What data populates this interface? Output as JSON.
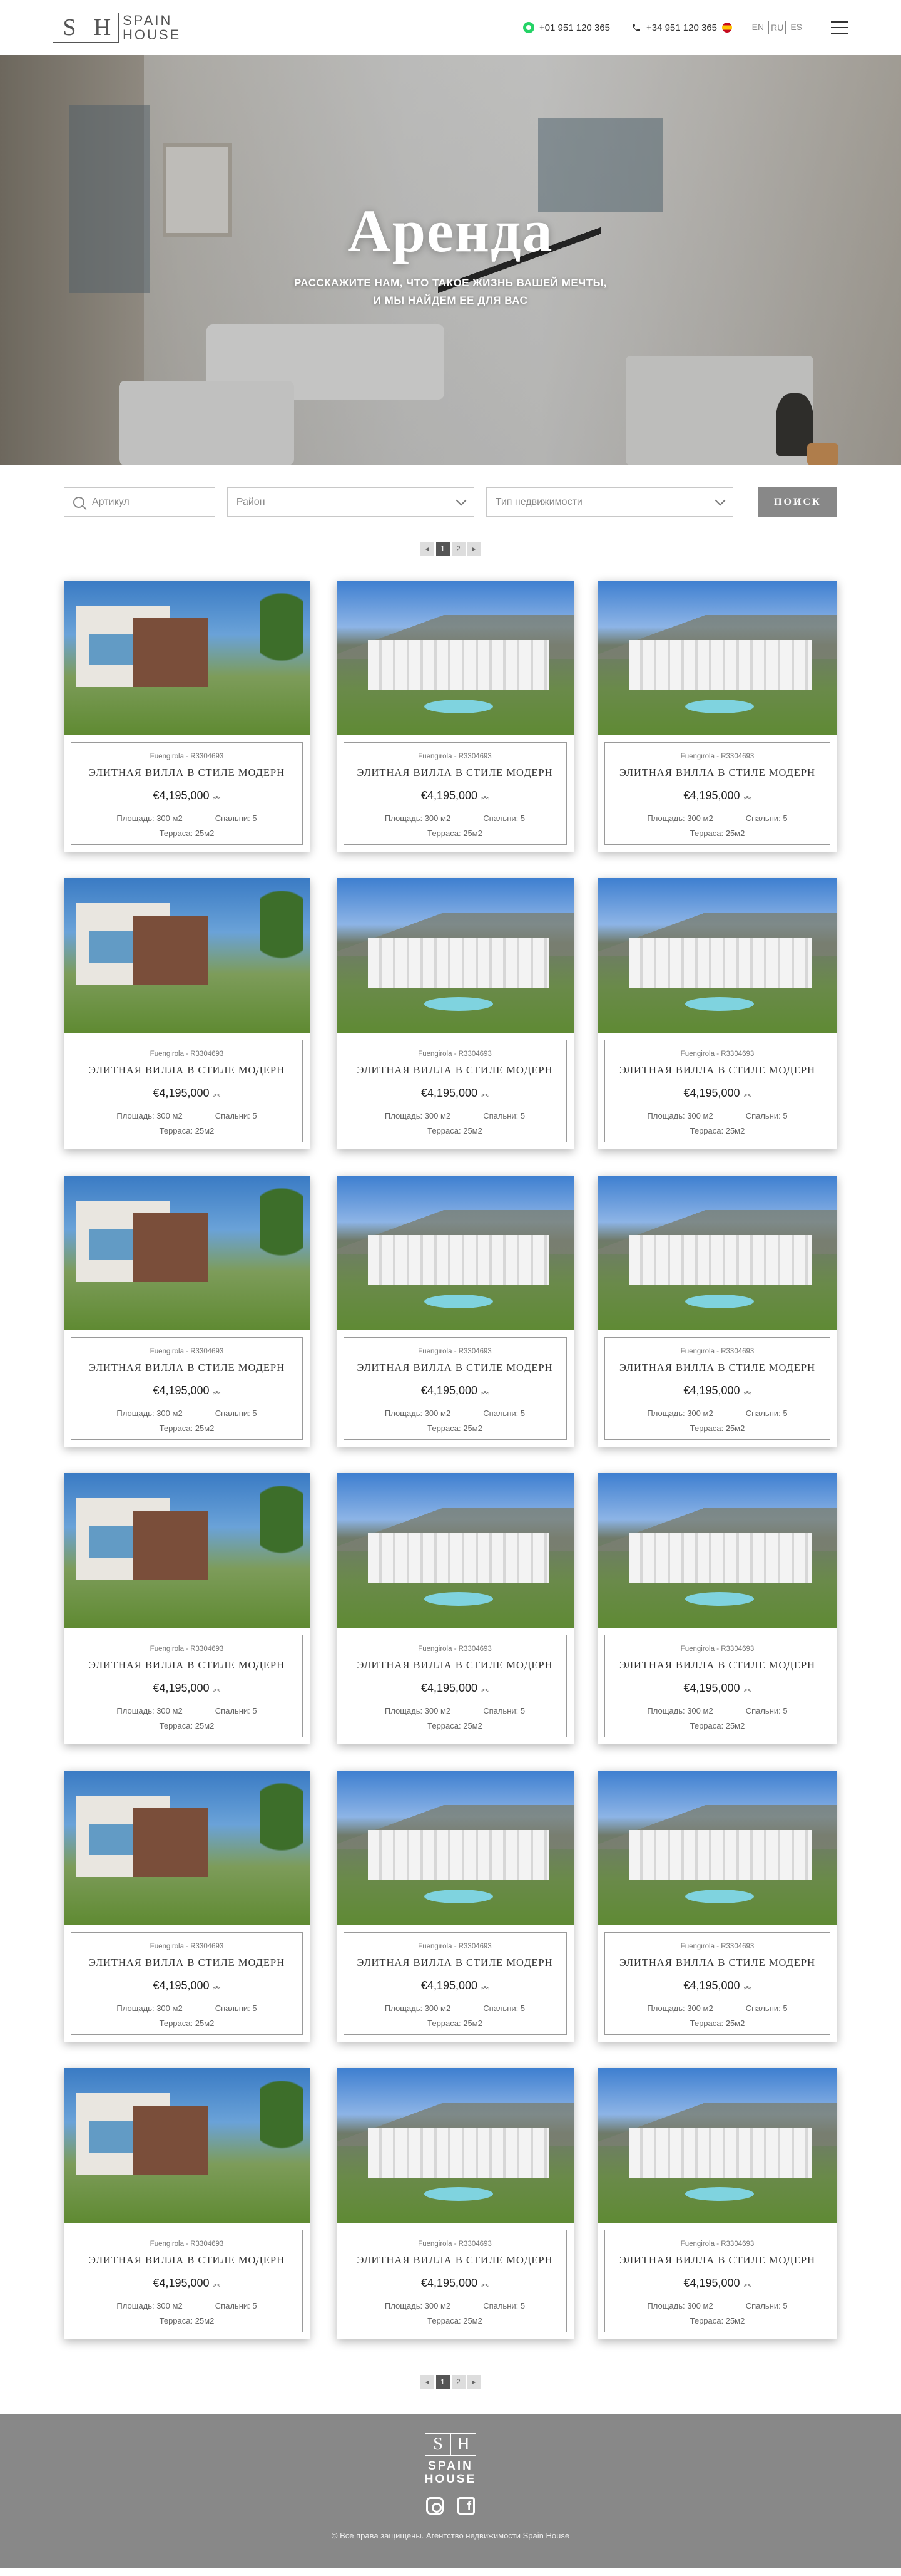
{
  "header": {
    "logo_left": "S",
    "logo_right": "H",
    "logo_line1": "SPAIN",
    "logo_line2": "HOUSE",
    "whatsapp_phone": "+01 951 120 365",
    "phone": "+34 951 120 365",
    "languages": [
      "EN",
      "RU",
      "ES"
    ],
    "active_language": "RU"
  },
  "hero": {
    "title": "Аренда",
    "subtitle_line1": "РАССКАЖИТЕ НАМ, ЧТО ТАКОЕ ЖИЗНЬ ВАШЕЙ МЕЧТЫ,",
    "subtitle_line2": "И МЫ НАЙДЕМ ЕЕ ДЛЯ ВАС"
  },
  "search": {
    "article_placeholder": "Артикул",
    "district_label": "Район",
    "type_label": "Тип недвижимости",
    "button_label": "ПОИСК"
  },
  "pagination": {
    "prev": "◂",
    "pages": [
      "1",
      "2"
    ],
    "next": "▸",
    "current": "1"
  },
  "listings": [
    {
      "image": "villa",
      "ref": "Fuengirola - R3304693",
      "title": "ЭЛИТНАЯ ВИЛЛА В СТИЛЕ МОДЕРН",
      "price": "€4,195,000",
      "area": "Площадь: 300 м2",
      "bedrooms": "Спальни: 5",
      "terrace": "Терраса: 25м2"
    },
    {
      "image": "apartments",
      "ref": "Fuengirola - R3304693",
      "title": "ЭЛИТНАЯ ВИЛЛА В СТИЛЕ МОДЕРН",
      "price": "€4,195,000",
      "area": "Площадь: 300 м2",
      "bedrooms": "Спальни: 5",
      "terrace": "Терраса: 25м2"
    },
    {
      "image": "apartments",
      "ref": "Fuengirola - R3304693",
      "title": "ЭЛИТНАЯ ВИЛЛА В СТИЛЕ МОДЕРН",
      "price": "€4,195,000",
      "area": "Площадь: 300 м2",
      "bedrooms": "Спальни: 5",
      "terrace": "Терраса: 25м2"
    },
    {
      "image": "villa",
      "ref": "Fuengirola - R3304693",
      "title": "ЭЛИТНАЯ ВИЛЛА В СТИЛЕ МОДЕРН",
      "price": "€4,195,000",
      "area": "Площадь: 300 м2",
      "bedrooms": "Спальни: 5",
      "terrace": "Терраса: 25м2"
    },
    {
      "image": "apartments",
      "ref": "Fuengirola - R3304693",
      "title": "ЭЛИТНАЯ ВИЛЛА В СТИЛЕ МОДЕРН",
      "price": "€4,195,000",
      "area": "Площадь: 300 м2",
      "bedrooms": "Спальни: 5",
      "terrace": "Терраса: 25м2"
    },
    {
      "image": "apartments",
      "ref": "Fuengirola - R3304693",
      "title": "ЭЛИТНАЯ ВИЛЛА В СТИЛЕ МОДЕРН",
      "price": "€4,195,000",
      "area": "Площадь: 300 м2",
      "bedrooms": "Спальни: 5",
      "terrace": "Терраса: 25м2"
    },
    {
      "image": "villa",
      "ref": "Fuengirola - R3304693",
      "title": "ЭЛИТНАЯ ВИЛЛА В СТИЛЕ МОДЕРН",
      "price": "€4,195,000",
      "area": "Площадь: 300 м2",
      "bedrooms": "Спальни: 5",
      "terrace": "Терраса: 25м2"
    },
    {
      "image": "apartments",
      "ref": "Fuengirola - R3304693",
      "title": "ЭЛИТНАЯ ВИЛЛА В СТИЛЕ МОДЕРН",
      "price": "€4,195,000",
      "area": "Площадь: 300 м2",
      "bedrooms": "Спальни: 5",
      "terrace": "Терраса: 25м2"
    },
    {
      "image": "apartments",
      "ref": "Fuengirola - R3304693",
      "title": "ЭЛИТНАЯ ВИЛЛА В СТИЛЕ МОДЕРН",
      "price": "€4,195,000",
      "area": "Площадь: 300 м2",
      "bedrooms": "Спальни: 5",
      "terrace": "Терраса: 25м2"
    },
    {
      "image": "villa",
      "ref": "Fuengirola - R3304693",
      "title": "ЭЛИТНАЯ ВИЛЛА В СТИЛЕ МОДЕРН",
      "price": "€4,195,000",
      "area": "Площадь: 300 м2",
      "bedrooms": "Спальни: 5",
      "terrace": "Терраса: 25м2"
    },
    {
      "image": "apartments",
      "ref": "Fuengirola - R3304693",
      "title": "ЭЛИТНАЯ ВИЛЛА В СТИЛЕ МОДЕРН",
      "price": "€4,195,000",
      "area": "Площадь: 300 м2",
      "bedrooms": "Спальни: 5",
      "terrace": "Терраса: 25м2"
    },
    {
      "image": "apartments",
      "ref": "Fuengirola - R3304693",
      "title": "ЭЛИТНАЯ ВИЛЛА В СТИЛЕ МОДЕРН",
      "price": "€4,195,000",
      "area": "Площадь: 300 м2",
      "bedrooms": "Спальни: 5",
      "terrace": "Терраса: 25м2"
    },
    {
      "image": "villa",
      "ref": "Fuengirola - R3304693",
      "title": "ЭЛИТНАЯ ВИЛЛА В СТИЛЕ МОДЕРН",
      "price": "€4,195,000",
      "area": "Площадь: 300 м2",
      "bedrooms": "Спальни: 5",
      "terrace": "Терраса: 25м2"
    },
    {
      "image": "apartments",
      "ref": "Fuengirola - R3304693",
      "title": "ЭЛИТНАЯ ВИЛЛА В СТИЛЕ МОДЕРН",
      "price": "€4,195,000",
      "area": "Площадь: 300 м2",
      "bedrooms": "Спальни: 5",
      "terrace": "Терраса: 25м2"
    },
    {
      "image": "apartments",
      "ref": "Fuengirola - R3304693",
      "title": "ЭЛИТНАЯ ВИЛЛА В СТИЛЕ МОДЕРН",
      "price": "€4,195,000",
      "area": "Площадь: 300 м2",
      "bedrooms": "Спальни: 5",
      "terrace": "Терраса: 25м2"
    },
    {
      "image": "villa",
      "ref": "Fuengirola - R3304693",
      "title": "ЭЛИТНАЯ ВИЛЛА В СТИЛЕ МОДЕРН",
      "price": "€4,195,000",
      "area": "Площадь: 300 м2",
      "bedrooms": "Спальни: 5",
      "terrace": "Терраса: 25м2"
    },
    {
      "image": "apartments",
      "ref": "Fuengirola - R3304693",
      "title": "ЭЛИТНАЯ ВИЛЛА В СТИЛЕ МОДЕРН",
      "price": "€4,195,000",
      "area": "Площадь: 300 м2",
      "bedrooms": "Спальни: 5",
      "terrace": "Терраса: 25м2"
    },
    {
      "image": "apartments",
      "ref": "Fuengirola - R3304693",
      "title": "ЭЛИТНАЯ ВИЛЛА В СТИЛЕ МОДЕРН",
      "price": "€4,195,000",
      "area": "Площадь: 300 м2",
      "bedrooms": "Спальни: 5",
      "terrace": "Терраса: 25м2"
    }
  ],
  "icons": {
    "whatsapp": "whatsapp-icon",
    "phone": "phone-icon",
    "flag": "spain-flag-icon",
    "menu": "menu-icon",
    "search": "search-icon",
    "dropdown": "chevron-down-icon",
    "price_marker": "chevrons-up-icon",
    "instagram": "instagram-icon",
    "facebook": "facebook-icon"
  },
  "footer": {
    "logo_left": "S",
    "logo_right": "H",
    "logo_line1": "SPAIN",
    "logo_line2": "HOUSE",
    "facebook_glyph": "f",
    "copyright": "© Все права защищены. Агентство недвижимости Spain House"
  },
  "colors": {
    "footer_bg": "#888888",
    "search_button_bg": "#888888",
    "whatsapp_green": "#25d366"
  }
}
